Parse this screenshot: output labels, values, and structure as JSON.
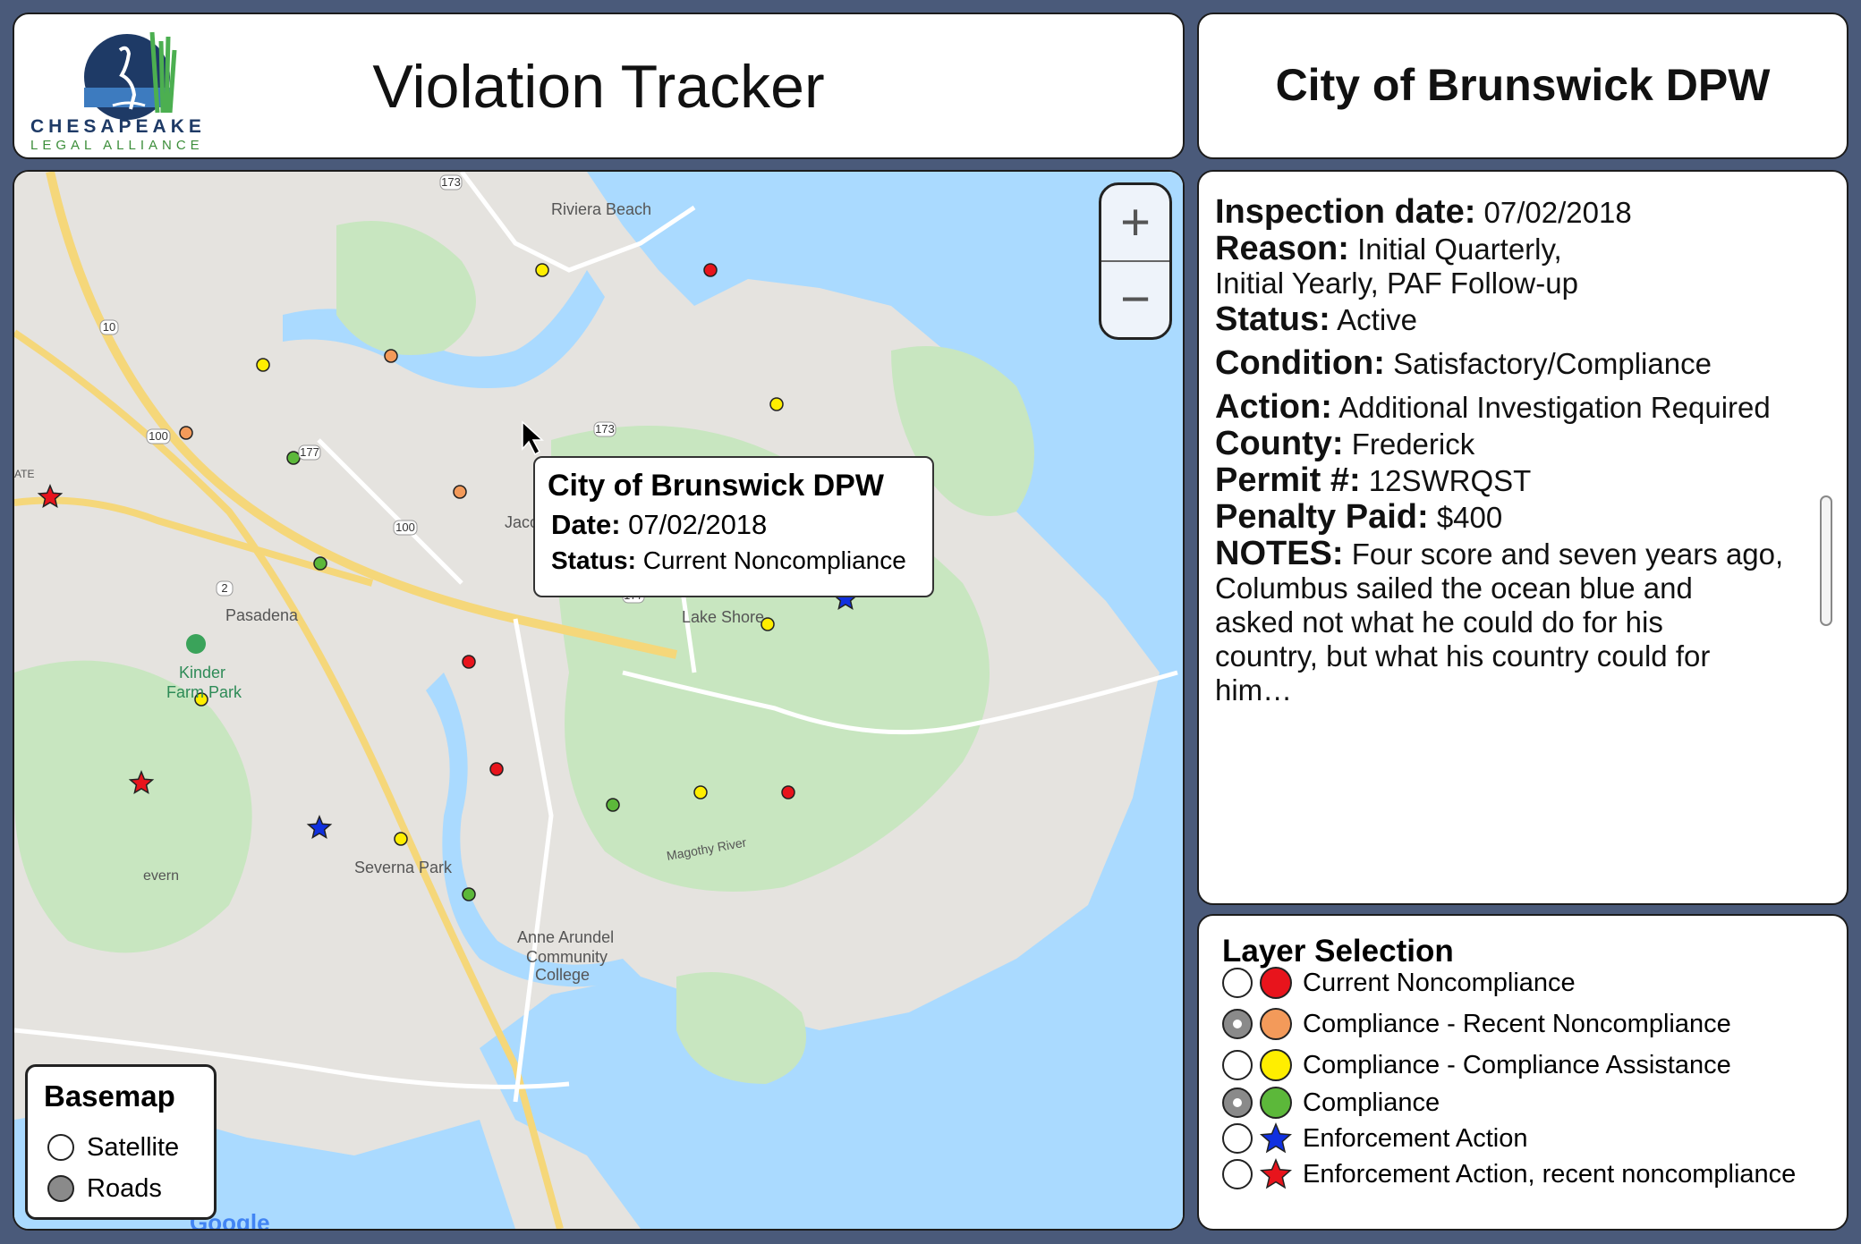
{
  "header": {
    "logo_line1": "CHESAPEAKE",
    "logo_line2": "LEGAL ALLIANCE",
    "app_title": "Violation Tracker"
  },
  "facility": {
    "name": "City of Brunswick DPW"
  },
  "map": {
    "place_labels": [
      "Riviera Beach",
      "Jacobsville",
      "Pasadena",
      "Lake Shore",
      "Kinder",
      "Farm Park",
      "Severna Park",
      "Anne Arundel",
      "Community",
      "College",
      "Magothy River",
      "ATE",
      "evern"
    ],
    "road_shields": [
      "173",
      "10",
      "100",
      "177",
      "100",
      "2",
      "177",
      "173"
    ],
    "attribution": "Google",
    "zoom": {
      "in": "+",
      "out": "−"
    }
  },
  "popup": {
    "title": "City of Brunswick DPW",
    "date_label": "Date:",
    "date": "07/02/2018",
    "status_label": "Status:",
    "status": "Current Noncompliance"
  },
  "basemap": {
    "title": "Basemap",
    "options": [
      {
        "label": "Satellite",
        "selected": false
      },
      {
        "label": "Roads",
        "selected": true
      }
    ]
  },
  "details": {
    "inspection_label": "Inspection date:",
    "inspection_date": "07/02/2018",
    "reason_label": "Reason:",
    "reason_line1": "Initial Quarterly,",
    "reason_line2": "Initial Yearly, PAF Follow-up",
    "status_label": "Status:",
    "status": "Active",
    "condition_label": "Condition:",
    "condition": "Satisfactory/Compliance",
    "action_label": "Action:",
    "action": "Additional Investigation Required",
    "county_label": "County:",
    "county": "Frederick",
    "permit_label": "Permit #:",
    "permit": "12SWRQST",
    "penalty_label": "Penalty Paid:",
    "penalty": "$400",
    "notes_label": "NOTES:",
    "notes_line1": "Four score and seven years ago,",
    "notes_line2": "Columbus sailed the ocean blue and",
    "notes_line3": "asked not what he could do for his",
    "notes_line4": "country, but what his country could for him…"
  },
  "layers": {
    "title": "Layer Selection",
    "items": [
      {
        "label": "Current Noncompliance",
        "color": "#e8141c",
        "shape": "circle",
        "selected": false
      },
      {
        "label": "Compliance - Recent Noncompliance",
        "color": "#f39a5a",
        "shape": "circle",
        "selected": true
      },
      {
        "label": "Compliance - Compliance Assistance",
        "color": "#ffee00",
        "shape": "circle",
        "selected": false
      },
      {
        "label": "Compliance",
        "color": "#5cb83a",
        "shape": "circle",
        "selected": true
      },
      {
        "label": "Enforcement Action",
        "color": "#1030e0",
        "shape": "star",
        "selected": false
      },
      {
        "label": "Enforcement Action, recent noncompliance",
        "color": "#e8141c",
        "shape": "star",
        "selected": false
      }
    ]
  },
  "markers": [
    {
      "type": "yellow"
    },
    {
      "type": "red"
    },
    {
      "type": "yellow"
    },
    {
      "type": "orange"
    },
    {
      "type": "yellow"
    },
    {
      "type": "orange"
    },
    {
      "type": "green"
    },
    {
      "type": "red-star"
    },
    {
      "type": "orange"
    },
    {
      "type": "red"
    },
    {
      "type": "green"
    },
    {
      "type": "green"
    },
    {
      "type": "orange"
    },
    {
      "type": "yellow"
    },
    {
      "type": "blue-star"
    },
    {
      "type": "red"
    },
    {
      "type": "yellow"
    },
    {
      "type": "red-star"
    },
    {
      "type": "red"
    },
    {
      "type": "green"
    },
    {
      "type": "yellow"
    },
    {
      "type": "red"
    },
    {
      "type": "blue-star"
    },
    {
      "type": "yellow"
    },
    {
      "type": "green"
    }
  ]
}
